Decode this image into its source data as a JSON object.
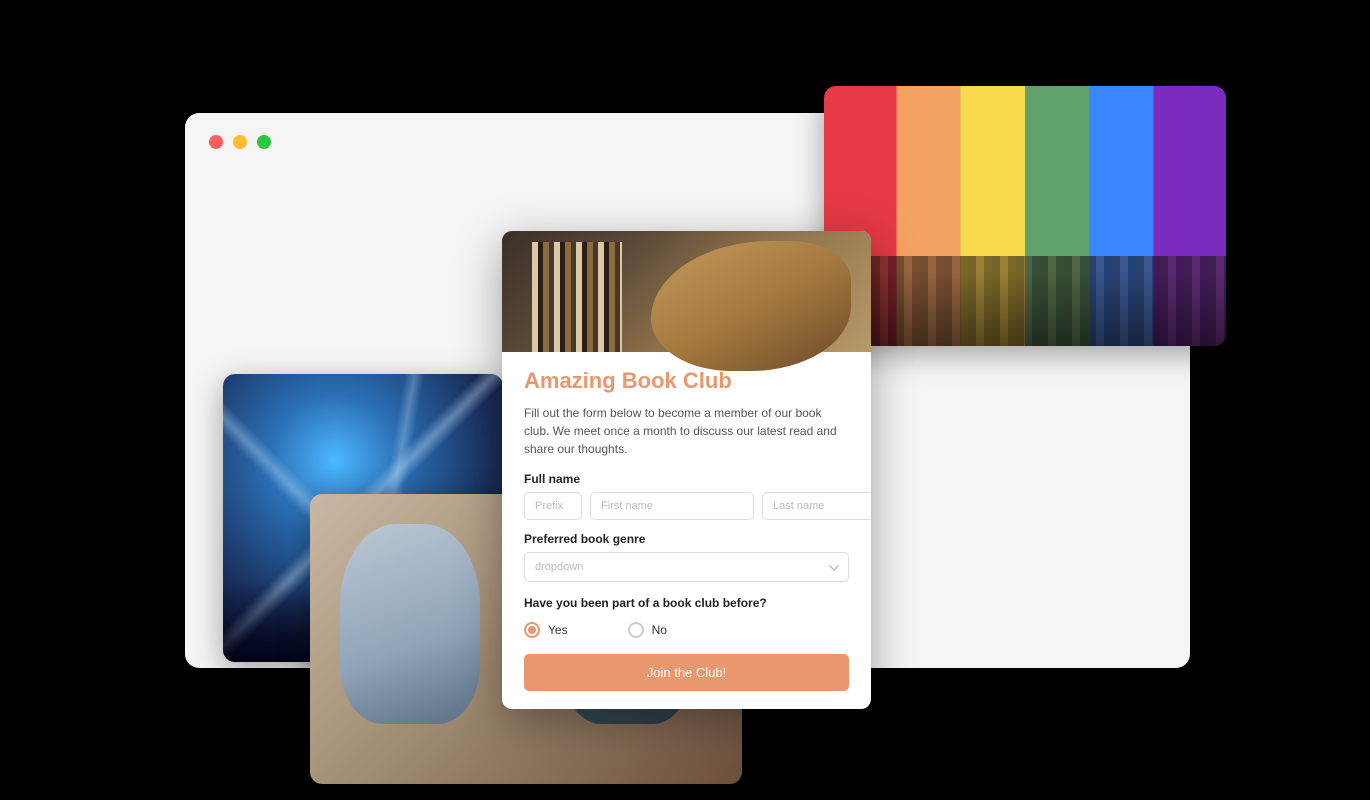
{
  "form": {
    "title": "Amazing Book Club",
    "description": "Fill out the form below to become a member of our book club. We meet once a month to discuss our latest read and share our thoughts.",
    "fullname_label": "Full name",
    "prefix_placeholder": "Prefix",
    "firstname_placeholder": "First name",
    "lastname_placeholder": "Last name",
    "genre_label": "Preferred book genre",
    "genre_placeholder": "dropdown",
    "prior_label": "Have you been part of a book club before?",
    "radio_yes": "Yes",
    "radio_no": "No",
    "submit_label": "Join the Club!"
  }
}
